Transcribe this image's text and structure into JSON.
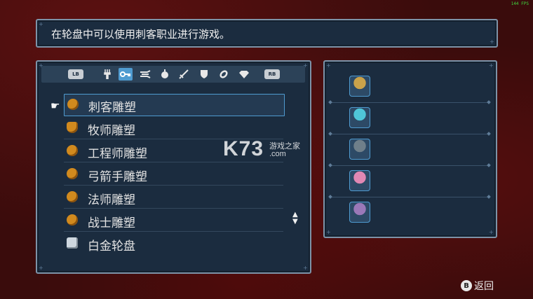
{
  "fps": "144 FPS",
  "dialog": {
    "text": "在轮盘中可以使用刺客职业进行游戏。"
  },
  "tabs": {
    "lb": "LB",
    "rb": "RB",
    "icons": [
      "fork-icon",
      "key-icon",
      "wing-icon",
      "apple-icon",
      "sword-icon",
      "shield-icon",
      "ring-icon",
      "gem-icon"
    ],
    "selected": "key-icon"
  },
  "items": [
    {
      "label": "刺客雕塑",
      "icon": "sculpture-icon"
    },
    {
      "label": "牧师雕塑",
      "icon": "sculpture-icon"
    },
    {
      "label": "工程师雕塑",
      "icon": "sculpture-icon"
    },
    {
      "label": "弓箭手雕塑",
      "icon": "sculpture-icon"
    },
    {
      "label": "法师雕塑",
      "icon": "sculpture-icon"
    },
    {
      "label": "战士雕塑",
      "icon": "sculpture-icon"
    },
    {
      "label": "白金轮盘",
      "icon": "platinum-wheel-icon"
    }
  ],
  "selected_item": "刺客雕塑",
  "characters": [
    {
      "name": "blonde-warrior-portrait",
      "color": "#caa24a"
    },
    {
      "name": "cyan-hair-portrait",
      "color": "#4fc6d8"
    },
    {
      "name": "masked-portrait",
      "color": "#6f7f8a"
    },
    {
      "name": "pink-creature-portrait",
      "color": "#e088b4"
    },
    {
      "name": "purple-mage-portrait",
      "color": "#9a78b8"
    }
  ],
  "footer": {
    "back_button": "B",
    "back_label": "返回"
  },
  "watermark": {
    "main": "K73",
    "sub": "游戏之家",
    "domain": ".com"
  }
}
